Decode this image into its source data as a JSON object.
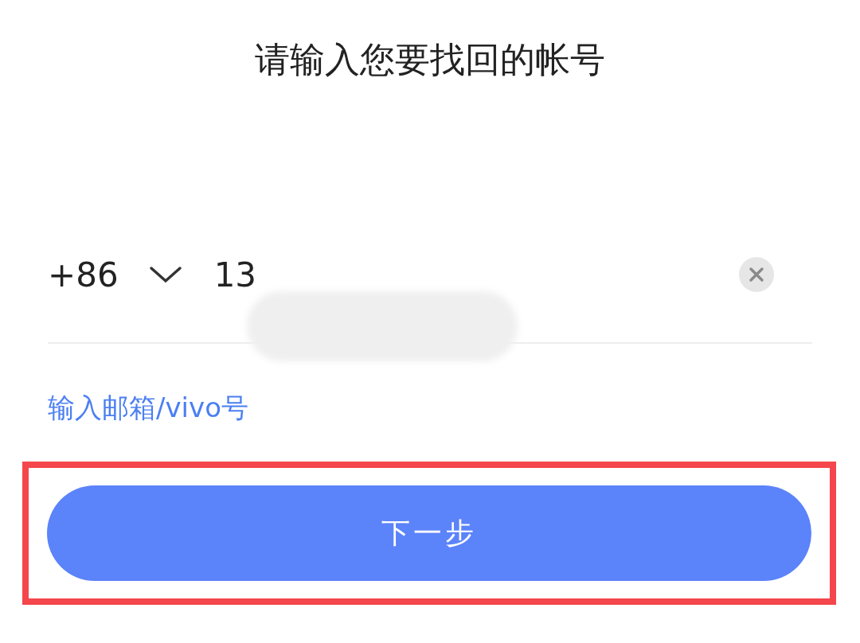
{
  "title": "请输入您要找回的帐号",
  "phone": {
    "country_code": "+86",
    "value": "13"
  },
  "alt_link": "输入邮箱/vivo号",
  "next_button": "下一步"
}
